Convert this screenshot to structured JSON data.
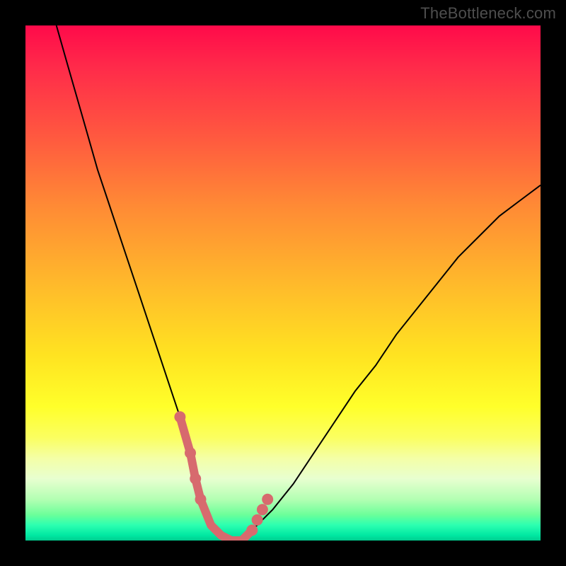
{
  "watermark": "TheBottleneck.com",
  "colors": {
    "frame": "#000000",
    "curve": "#000000",
    "highlight": "#d76a6e"
  },
  "chart_data": {
    "type": "line",
    "title": "",
    "xlabel": "",
    "ylabel": "",
    "xlim": [
      0,
      100
    ],
    "ylim": [
      0,
      100
    ],
    "grid": false,
    "legend": false,
    "series": [
      {
        "name": "bottleneck-curve",
        "x": [
          6,
          8,
          10,
          12,
          14,
          16,
          18,
          20,
          22,
          24,
          26,
          28,
          30,
          32,
          33,
          34,
          36,
          38,
          40,
          42,
          44,
          48,
          52,
          56,
          60,
          64,
          68,
          72,
          76,
          80,
          84,
          88,
          92,
          96,
          100
        ],
        "y": [
          100,
          93,
          86,
          79,
          72,
          66,
          60,
          54,
          48,
          42,
          36,
          30,
          24,
          17,
          12,
          8,
          3,
          1,
          0,
          0,
          2,
          6,
          11,
          17,
          23,
          29,
          34,
          40,
          45,
          50,
          55,
          59,
          63,
          66,
          69
        ]
      }
    ],
    "highlight_segment": {
      "x": [
        30,
        32,
        33,
        34,
        36,
        38,
        40,
        42,
        44
      ],
      "y": [
        24,
        17,
        12,
        8,
        3,
        1,
        0,
        0,
        2
      ]
    },
    "highlight_dots": [
      {
        "x": 30,
        "y": 24
      },
      {
        "x": 32,
        "y": 17
      },
      {
        "x": 33,
        "y": 12
      },
      {
        "x": 34,
        "y": 8
      },
      {
        "x": 44,
        "y": 2
      },
      {
        "x": 45,
        "y": 4
      },
      {
        "x": 46,
        "y": 6
      },
      {
        "x": 47,
        "y": 8
      }
    ]
  }
}
